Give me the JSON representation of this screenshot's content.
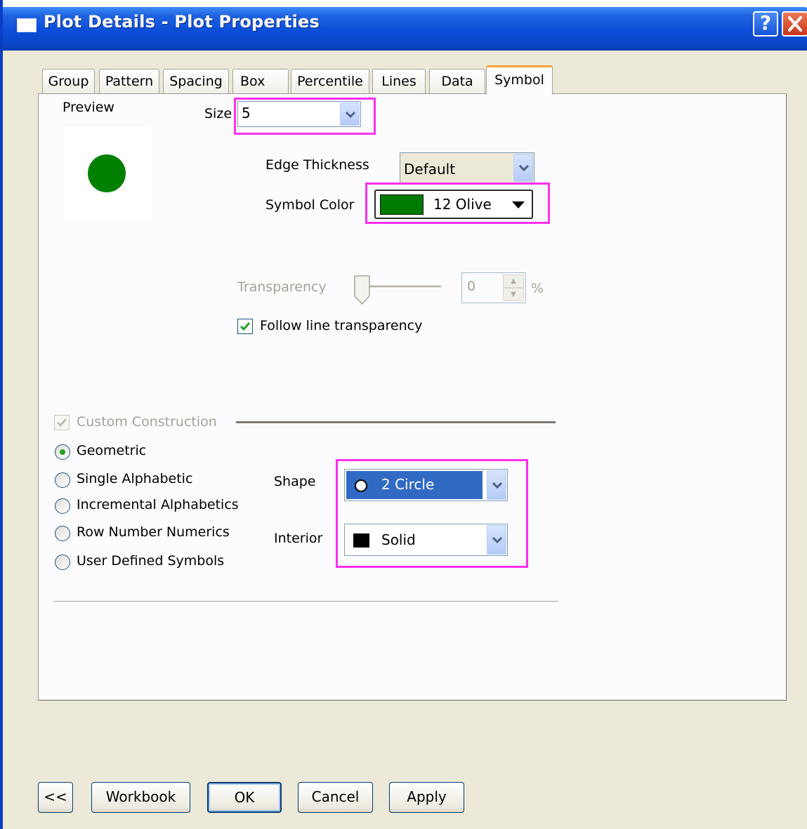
{
  "window": {
    "title": "Plot Details - Plot Properties",
    "help_label": "?",
    "close_label": "✕"
  },
  "tabs": [
    {
      "label": "Group"
    },
    {
      "label": "Pattern"
    },
    {
      "label": "Spacing"
    },
    {
      "label": "Box"
    },
    {
      "label": "Percentile"
    },
    {
      "label": "Lines"
    },
    {
      "label": "Data"
    },
    {
      "label": "Symbol",
      "active": true
    }
  ],
  "symbol": {
    "preview_label": "Preview",
    "preview_color": "#008000",
    "size_label": "Size",
    "size_value": "5",
    "edge_thickness_label": "Edge Thickness",
    "edge_thickness_value": "Default",
    "symbol_color_label": "Symbol Color",
    "symbol_color_value": "12 Olive",
    "symbol_color_hex": "#007a00",
    "transparency_label": "Transparency",
    "transparency_value": "0",
    "transparency_unit": "%",
    "follow_line_transparency_label": "Follow line transparency",
    "follow_line_transparency_checked": true
  },
  "construction": {
    "custom_construction_label": "Custom Construction",
    "custom_construction_checked": true,
    "options": [
      {
        "label": "Geometric",
        "selected": true
      },
      {
        "label": "Single Alphabetic",
        "selected": false
      },
      {
        "label": "Incremental Alphabetics",
        "selected": false
      },
      {
        "label": "Row Number Numerics",
        "selected": false
      },
      {
        "label": "User Defined Symbols",
        "selected": false
      }
    ],
    "shape_label": "Shape",
    "shape_value": "2 Circle",
    "interior_label": "Interior",
    "interior_value": "Solid"
  },
  "footer": {
    "collapse_label": "<<",
    "workbook_label": "Workbook",
    "ok_label": "OK",
    "cancel_label": "Cancel",
    "apply_label": "Apply"
  },
  "colors": {
    "highlight": "#ff2ef0",
    "selected_combo": "#316ac5"
  }
}
